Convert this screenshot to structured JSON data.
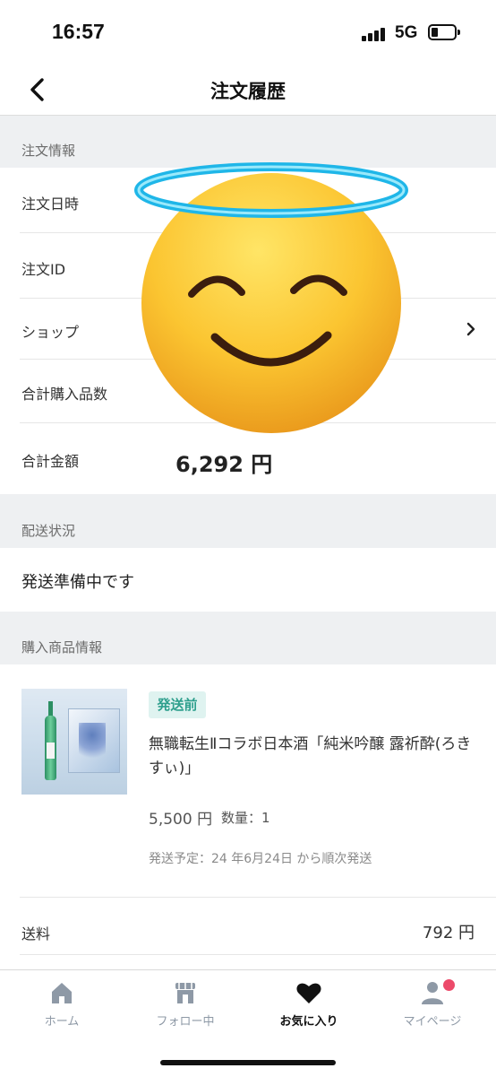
{
  "status_bar": {
    "time": "16:57",
    "network": "5G"
  },
  "header": {
    "title": "注文履歴"
  },
  "order_info": {
    "section_label": "注文情報",
    "rows": [
      {
        "key": "注文日時",
        "value": ""
      },
      {
        "key": "注文ID",
        "value": ""
      },
      {
        "key": "ショップ",
        "value": ""
      },
      {
        "key": "合計購入品数",
        "value": ""
      },
      {
        "key": "合計金額",
        "value": "6,292 円"
      }
    ]
  },
  "delivery": {
    "section_label": "配送状況",
    "status": "発送準備中です"
  },
  "products": {
    "section_label": "購入商品情報",
    "item": {
      "badge": "発送前",
      "name": "無職転生Ⅱコラボ日本酒「純米吟醸 露祈酔(ろきすぃ)」",
      "price": "5,500 円",
      "quantity": "数量：1",
      "schedule": "発送予定：24 年6月24日 から順次発送"
    },
    "shipping_fee_label": "送料",
    "shipping_fee": "792 円"
  },
  "tabs": [
    {
      "label": "ホーム",
      "icon": "home-icon"
    },
    {
      "label": "フォロー中",
      "icon": "shop-icon"
    },
    {
      "label": "お気に入り",
      "icon": "heart-icon",
      "active": true
    },
    {
      "label": "マイページ",
      "icon": "person-icon",
      "notification": true
    }
  ],
  "overlay": {
    "icon": "smiling-face-with-halo-emoji"
  },
  "colors": {
    "badge_text": "#2e9f8d",
    "badge_bg": "#dff3f0",
    "notification_dot": "#ec4a6a",
    "section_bg": "#eef0f2"
  }
}
